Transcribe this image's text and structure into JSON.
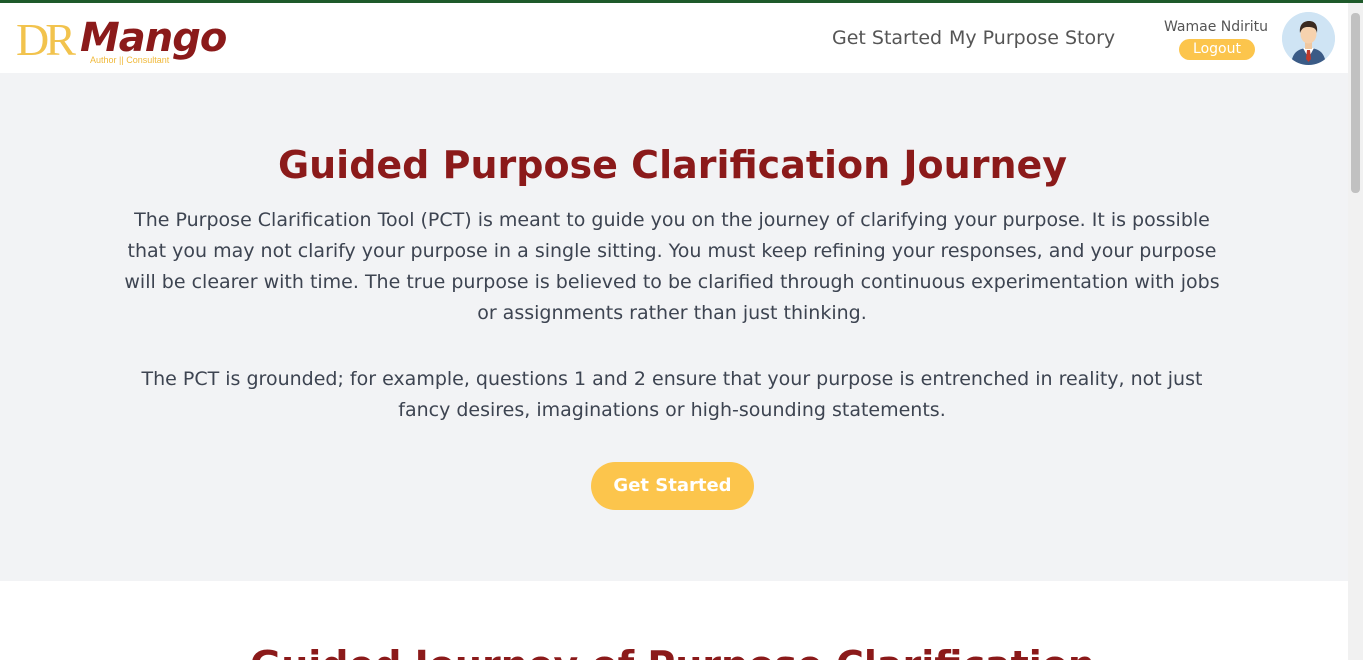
{
  "brand": {
    "logo_dr": "DR",
    "logo_name": "Mango",
    "logo_tagline": "Author || Consultant"
  },
  "nav": {
    "get_started": "Get Started",
    "purpose_story": "My Purpose Story"
  },
  "user": {
    "name": "Wamae Ndiritu",
    "logout_label": "Logout"
  },
  "hero": {
    "title": "Guided Purpose Clarification Journey",
    "paragraph1": "The Purpose Clarification Tool (PCT) is meant to guide you on the journey of clarifying your purpose. It is possible that you may not clarify your purpose in a single sitting. You must keep refining your responses, and your purpose will be clearer with time. The true purpose is believed to be clarified through continuous experimentation with jobs or assignments rather than just thinking.",
    "paragraph2": "The PCT is grounded; for example, questions 1 and 2 ensure that your purpose is entrenched in reality, not just fancy desires, imaginations or high-sounding statements.",
    "cta_label": "Get Started"
  },
  "next_section": {
    "title": "Guided Journey of Purpose Clarification"
  },
  "colors": {
    "brand_red": "#8b1a1a",
    "brand_yellow": "#fcc54c",
    "hero_bg": "#f2f3f5",
    "top_border": "#1e5a2a"
  },
  "icons": {
    "avatar": "user-avatar-icon"
  }
}
